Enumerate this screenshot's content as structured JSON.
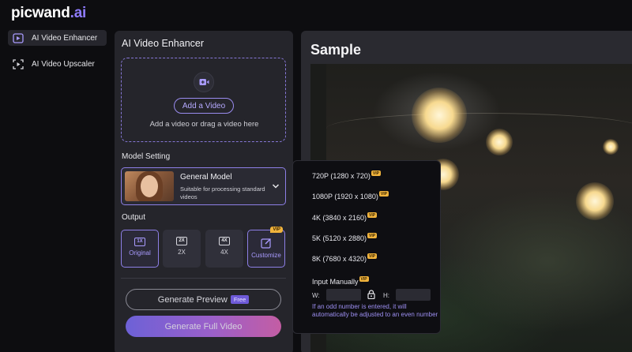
{
  "logo": {
    "main": "picwand",
    "dot": ".ai"
  },
  "sidebar": {
    "items": [
      {
        "label": "AI Video Enhancer",
        "icon": "video-enhance-icon",
        "active": true
      },
      {
        "label": "AI Video Upscaler",
        "icon": "video-upscale-icon",
        "active": false
      }
    ]
  },
  "panel": {
    "title": "AI Video Enhancer",
    "dropzone": {
      "button": "Add a Video",
      "hint": "Add a video or drag a video here"
    },
    "model_section": "Model Setting",
    "model": {
      "name": "General Model",
      "desc": "Suitable for processing standard videos"
    },
    "output_section": "Output",
    "output_options": [
      {
        "badge": "1X",
        "label": "Original",
        "selected": true
      },
      {
        "badge": "2X",
        "label": "2X",
        "selected": false
      },
      {
        "badge": "4X",
        "label": "4X",
        "selected": false
      },
      {
        "label": "Customize",
        "vip": "VIP",
        "selected": false
      }
    ],
    "preview_button": "Generate Preview",
    "preview_tag": "Free",
    "full_button": "Generate Full Video"
  },
  "sample": {
    "title": "Sample"
  },
  "resolution_menu": {
    "items": [
      {
        "label": "720P (1280 x 720)",
        "vip": "VIP"
      },
      {
        "label": "1080P (1920 x 1080)",
        "vip": "VIP"
      },
      {
        "label": "4K (3840 x 2160)",
        "vip": "VIP"
      },
      {
        "label": "5K (5120 x 2880)",
        "vip": "VIP"
      },
      {
        "label": "8K (7680 x 4320)",
        "vip": "VIP"
      }
    ],
    "manual_label": "Input Manually",
    "manual_vip": "VIP",
    "width_label": "W:",
    "height_label": "H:",
    "width_value": "",
    "height_value": "",
    "note": "If an odd number is entered, it will automatically be adjusted to an even number"
  },
  "colors": {
    "accent": "#8d7fe6",
    "vip": "#f0b33c",
    "note": "#9d8ff2"
  }
}
